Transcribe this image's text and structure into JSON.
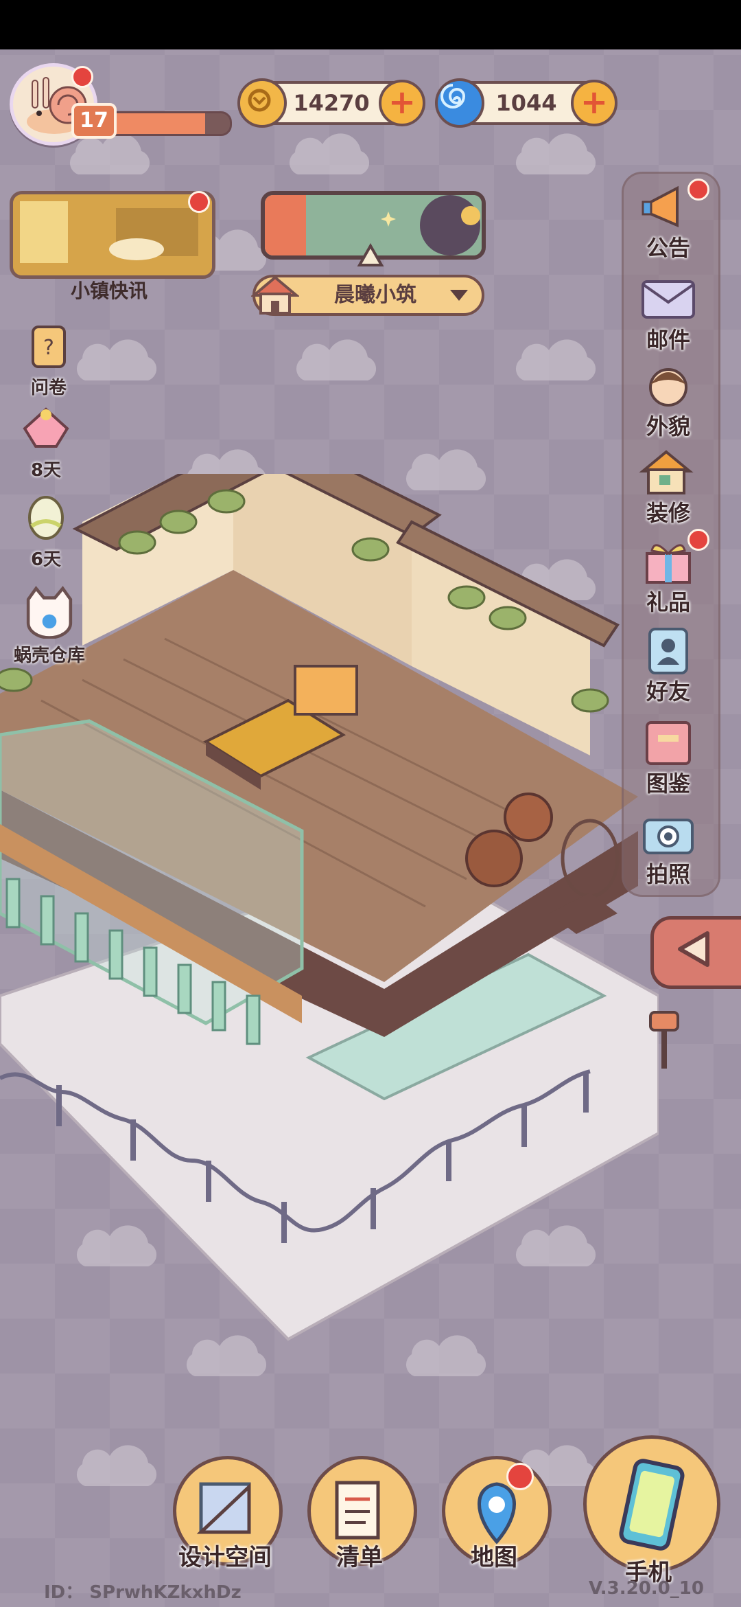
{
  "player": {
    "level": "17",
    "xp_fraction": 0.8
  },
  "currency": [
    {
      "name": "gold-coin",
      "value": "14270"
    },
    {
      "name": "snail-shell-gem",
      "value": "1044"
    }
  ],
  "news": {
    "label": "小镇快讯"
  },
  "house": {
    "name": "晨曦小筑"
  },
  "left_menu": [
    {
      "id": "survey",
      "label": "问卷"
    },
    {
      "id": "event-8",
      "label": "8天"
    },
    {
      "id": "event-6",
      "label": "6天"
    },
    {
      "id": "warehouse",
      "label": "蜗壳仓库"
    }
  ],
  "right_menu": [
    {
      "id": "announcement",
      "label": "公告"
    },
    {
      "id": "mail",
      "label": "邮件"
    },
    {
      "id": "appearance",
      "label": "外貌"
    },
    {
      "id": "decorate",
      "label": "装修"
    },
    {
      "id": "gift",
      "label": "礼品"
    },
    {
      "id": "friends",
      "label": "好友"
    },
    {
      "id": "catalog",
      "label": "图鉴"
    },
    {
      "id": "photo",
      "label": "拍照"
    }
  ],
  "bottom_menu": [
    {
      "id": "design",
      "label": "设计空间"
    },
    {
      "id": "list",
      "label": "清单"
    },
    {
      "id": "map",
      "label": "地图"
    },
    {
      "id": "phone",
      "label": "手机"
    }
  ],
  "footer": {
    "id_text": "ID： SPrwhKZkxhDz",
    "version": "V.3.20.0_10"
  },
  "colors": {
    "accent": "#e4443e",
    "panel": "#f5c77a",
    "bg": "#9e93a6"
  }
}
